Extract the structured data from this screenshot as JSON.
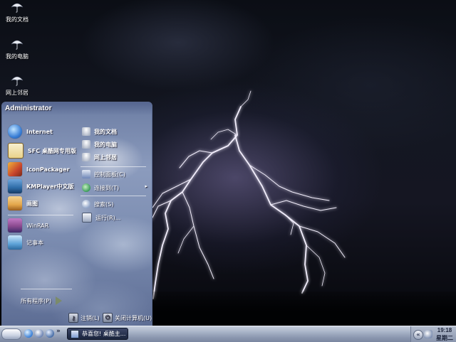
{
  "desktop": {
    "icons": [
      {
        "label": "我的文档",
        "icon": "umbrella-icon"
      },
      {
        "label": "我的电脑",
        "icon": "umbrella-icon"
      },
      {
        "label": "网上邻居",
        "icon": "umbrella-icon"
      }
    ]
  },
  "start_menu": {
    "user": "Administrator",
    "programs": [
      {
        "label": "Internet",
        "icon": "ie-globe-icon",
        "color": "#3a7fd6"
      },
      {
        "label": "SFC 桌酷网专用版",
        "icon": "sfc-app-icon",
        "color": "#e9d38b"
      },
      {
        "label": "IconPackager",
        "icon": "iconpackager-icon",
        "color": "#c8452c"
      },
      {
        "label": "KMPlayer中文版",
        "icon": "kmplayer-icon",
        "color": "#2e6ca8"
      },
      {
        "label": "画图",
        "icon": "paint-icon",
        "color": "#e3a64a"
      },
      {
        "label": "WinRAR",
        "icon": "winrar-icon",
        "color": "#8b4a8f"
      },
      {
        "label": "记事本",
        "icon": "notepad-icon",
        "color": "#5ea3d8"
      }
    ],
    "places": [
      {
        "label": "我的文档",
        "icon": "umbrella-icon"
      },
      {
        "label": "我的电脑",
        "icon": "umbrella-icon"
      },
      {
        "label": "网上邻居",
        "icon": "umbrella-icon"
      },
      {
        "label": "控制面板(C)",
        "icon": "control-panel-icon"
      },
      {
        "label": "连接到(T)",
        "icon": "connect-to-icon"
      },
      {
        "label": "搜索(S)",
        "icon": "search-icon"
      },
      {
        "label": "运行(R)...",
        "icon": "run-icon"
      }
    ],
    "all_programs": "所有程序(P)",
    "logoff": "注销(L)",
    "shutdown": "关闭计算机(U)"
  },
  "taskbar": {
    "chevron": "»",
    "task_button": "恭喜您! 桌酷主...",
    "clock_time": "19:18",
    "clock_day": "星期二",
    "tray_arrow": "«"
  }
}
